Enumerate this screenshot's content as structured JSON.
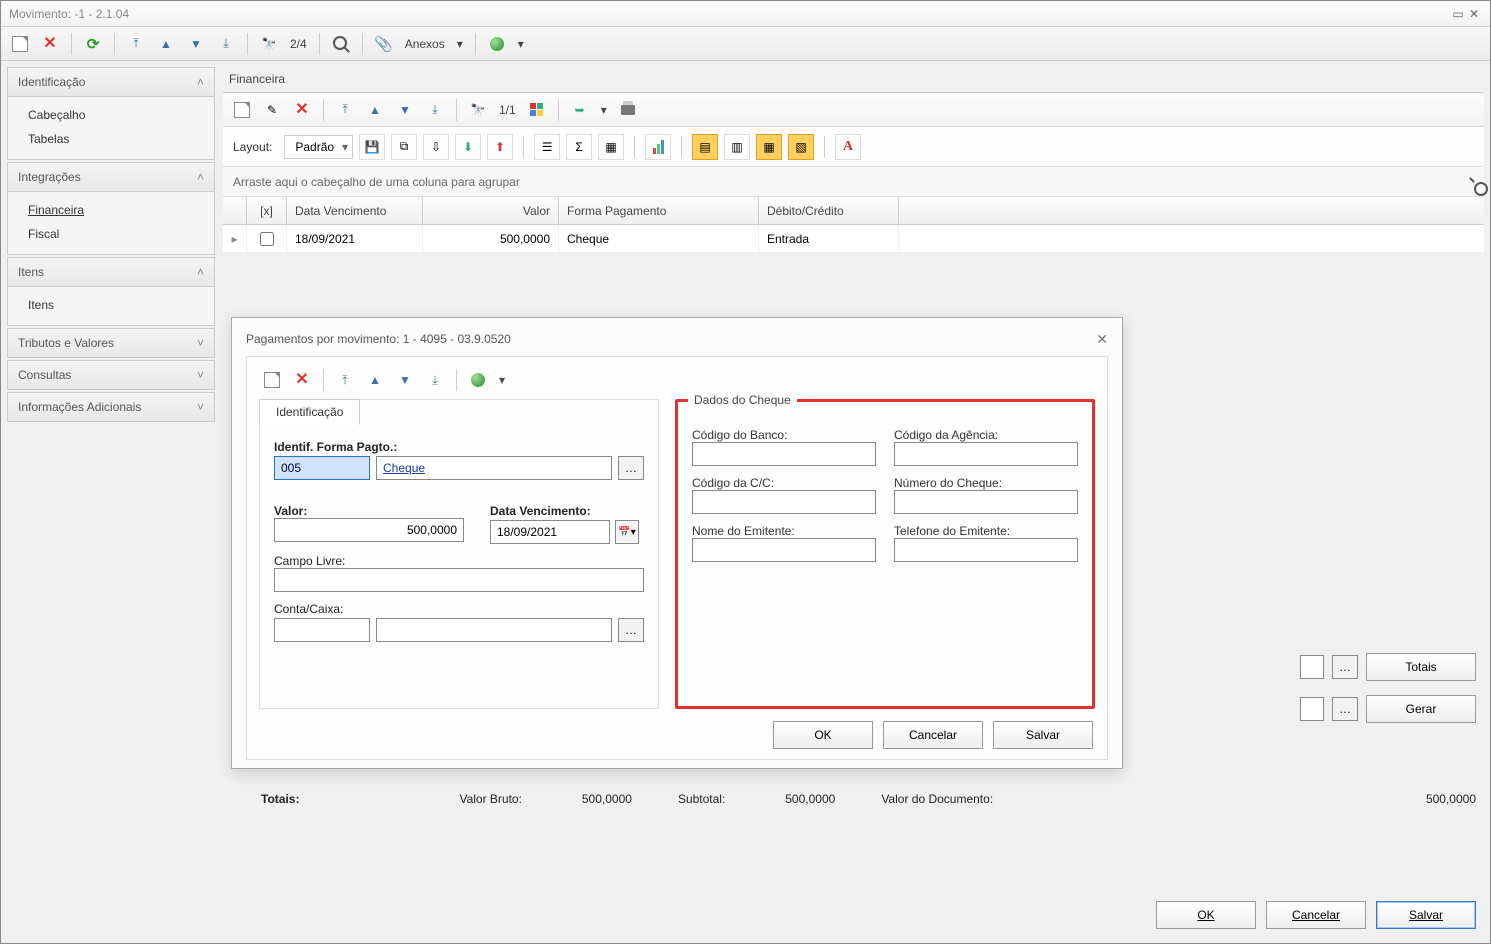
{
  "window": {
    "title": "Movimento: -1 - 2.1.04"
  },
  "toolbar": {
    "counter": "2/4",
    "anexos_label": "Anexos"
  },
  "sidebar": {
    "sections": [
      {
        "title": "Identificação",
        "expanded": true,
        "items": [
          "Cabeçalho",
          "Tabelas"
        ]
      },
      {
        "title": "Integrações",
        "expanded": true,
        "items": [
          "Financeira",
          "Fiscal"
        ],
        "activeIndex": 0
      },
      {
        "title": "Itens",
        "expanded": true,
        "items": [
          "Itens"
        ]
      },
      {
        "title": "Tributos e Valores",
        "expanded": false
      },
      {
        "title": "Consultas",
        "expanded": false
      },
      {
        "title": "Informações Adicionais",
        "expanded": false
      }
    ]
  },
  "main": {
    "section_title": "Financeira",
    "inner_counter": "1/1",
    "layout_label": "Layout:",
    "layout_value": "Padrão",
    "group_hint": "Arraste aqui o cabeçalho de uma coluna para agrupar",
    "columns": {
      "chk": "[x]",
      "data": "Data Vencimento",
      "valor": "Valor",
      "forma": "Forma Pagamento",
      "deb": "Débito/Crédito"
    },
    "rows": [
      {
        "data": "18/09/2021",
        "valor": "500,0000",
        "forma": "Cheque",
        "deb": "Entrada"
      }
    ]
  },
  "dialog": {
    "title": "Pagamentos por movimento: 1 - 4095 - 03.9.0520",
    "tab": "Identificação",
    "left": {
      "ident_label": "Identif. Forma Pagto.:",
      "ident_code": "005",
      "ident_link": "Cheque",
      "valor_label": "Valor:",
      "valor_value": "500,0000",
      "dataven_label": "Data Vencimento:",
      "dataven_value": "18/09/2021",
      "campolivre_label": "Campo Livre:",
      "contacaixa_label": "Conta/Caixa:"
    },
    "right": {
      "title": "Dados do Cheque",
      "codbanco": "Código do Banco:",
      "codagencia": "Código da Agência:",
      "codcc": "Código da C/C:",
      "numcheque": "Número do Cheque:",
      "nomeemit": "Nome do Emitente:",
      "telemit": "Telefone do Emitente:"
    },
    "buttons": {
      "ok": "OK",
      "cancel": "Cancelar",
      "save": "Salvar"
    }
  },
  "behind": {
    "totais": "Totais",
    "gerar": "Gerar"
  },
  "totals": {
    "label": "Totais:",
    "bruto_label": "Valor Bruto:",
    "bruto": "500,0000",
    "subtotal_label": "Subtotal:",
    "subtotal": "500,0000",
    "doc_label": "Valor do Documento:",
    "doc": "500,0000"
  },
  "bottom": {
    "ok": "OK",
    "cancel": "Cancelar",
    "save": "Salvar"
  }
}
